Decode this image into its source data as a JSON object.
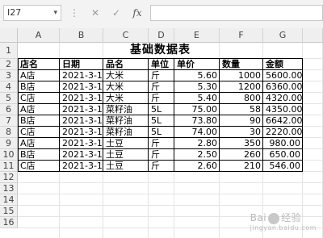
{
  "formula_bar": {
    "name_box": "I27",
    "cancel_icon": "✕",
    "confirm_icon": "✓",
    "fx_label": "fx",
    "formula_value": ""
  },
  "columns": [
    "A",
    "B",
    "C",
    "D",
    "E",
    "F",
    "G"
  ],
  "rows": [
    "1",
    "2",
    "3",
    "4",
    "5",
    "6",
    "7",
    "8",
    "9",
    "10",
    "11",
    "12",
    "13",
    "14",
    "15",
    "16"
  ],
  "sheet": {
    "title": "基础数据表",
    "headers": [
      "店名",
      "日期",
      "品名",
      "单位",
      "单价",
      "数量",
      "金额"
    ],
    "data": [
      [
        "A店",
        "2021-3-1",
        "大米",
        "斤",
        "5.60",
        "1000",
        "5600.00"
      ],
      [
        "B店",
        "2021-3-1",
        "大米",
        "斤",
        "5.30",
        "1200",
        "6360.00"
      ],
      [
        "C店",
        "2021-3-1",
        "大米",
        "斤",
        "5.40",
        "800",
        "4320.00"
      ],
      [
        "A店",
        "2021-3-1",
        "菜籽油",
        "5L",
        "75.00",
        "58",
        "4350.00"
      ],
      [
        "B店",
        "2021-3-1",
        "菜籽油",
        "5L",
        "73.80",
        "90",
        "6642.00"
      ],
      [
        "C店",
        "2021-3-1",
        "菜籽油",
        "5L",
        "74.00",
        "30",
        "2220.00"
      ],
      [
        "A店",
        "2021-3-1",
        "土豆",
        "斤",
        "2.80",
        "350",
        "980.00"
      ],
      [
        "B店",
        "2021-3-1",
        "土豆",
        "斤",
        "2.50",
        "260",
        "650.00"
      ],
      [
        "C店",
        "2021-3-1",
        "土豆",
        "斤",
        "2.60",
        "210",
        "546.00"
      ]
    ]
  },
  "watermark": {
    "text_left": "Bai",
    "text_right": "经验",
    "sub": "jingyan.baidu.com"
  }
}
